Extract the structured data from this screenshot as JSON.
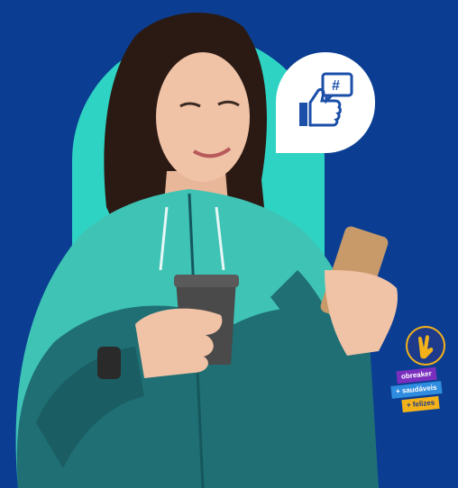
{
  "colors": {
    "background": "#0b3e92",
    "arch": "#2fd3c4",
    "bubble": "#ffffff",
    "icon": "#1b4fa8",
    "jacket_light": "#3ec3b5",
    "jacket_dark": "#1f6f74",
    "ribbon_purple": "#7b2fbf",
    "ribbon_blue": "#2f8de0",
    "ribbon_yellow": "#f3b21a",
    "badge_circle": "#1e3a8a"
  },
  "icons": {
    "bubble_icon": "thumbs-up-with-hashtag-speech-bubble",
    "badge_icon": "victory-hand"
  },
  "badge": {
    "line1": "obreaker",
    "line2": "+ saudáveis",
    "line3": "+ felizes"
  }
}
